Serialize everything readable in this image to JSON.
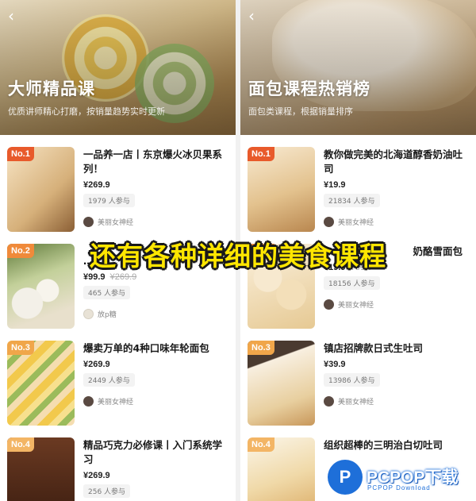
{
  "left": {
    "back_glyph": "‹",
    "hero_title": "大师精品课",
    "hero_subtitle": "优质讲师精心打磨，按销量趋势实时更新",
    "items": [
      {
        "rank": "No.1",
        "title": "一品养一店丨东京爆火冰贝果系列！",
        "price": "¥269.9",
        "old_price": "",
        "count": "1979 人参与",
        "author": "美丽女神经"
      },
      {
        "rank": "No.2",
        "title": "…",
        "price": "¥99.9",
        "old_price": "¥269.9",
        "count": "465 人参与",
        "author": "放p糖"
      },
      {
        "rank": "No.3",
        "title": "爆卖万单的4种口味年轮面包",
        "price": "¥269.9",
        "old_price": "",
        "count": "2449 人参与",
        "author": "美丽女神经"
      },
      {
        "rank": "No.4",
        "title": "精品巧克力必修课丨入门系统学习",
        "price": "¥269.9",
        "old_price": "",
        "count": "256 人参与",
        "author": ""
      }
    ]
  },
  "right": {
    "back_glyph": "‹",
    "hero_title": "面包课程热销榜",
    "hero_subtitle": "面包类课程，根据销量排序",
    "items": [
      {
        "rank": "No.1",
        "title": "教你做完美的北海道醇香奶油吐司",
        "price": "¥19.9",
        "old_price": "",
        "count": "21834 人参与",
        "author": "美丽女神经"
      },
      {
        "rank": "No.2",
        "title": "奶酪雪面包",
        "price": "¥19.9",
        "old_price": "¥39.9",
        "count": "18156 人参与",
        "author": "美丽女神经"
      },
      {
        "rank": "No.3",
        "title": "镇店招牌款日式生吐司",
        "price": "¥39.9",
        "old_price": "",
        "count": "13986 人参与",
        "author": "美丽女神经"
      },
      {
        "rank": "No.4",
        "title": "组织超棒的三明治白切吐司",
        "price": "",
        "old_price": "",
        "count": "",
        "author": ""
      }
    ]
  },
  "overlay": {
    "caption": "还有各种详细的美食课程"
  },
  "watermark": {
    "logo_letter": "P",
    "main": "PCPOP下载",
    "sub": "PCPOP Download"
  },
  "colors": {
    "rank1": "#e85a2b",
    "rank2": "#f08a3a",
    "rank3": "#f0a64a",
    "rank4": "#f3b565",
    "caption": "#ffe600",
    "watermark": "#1e6fd9"
  }
}
